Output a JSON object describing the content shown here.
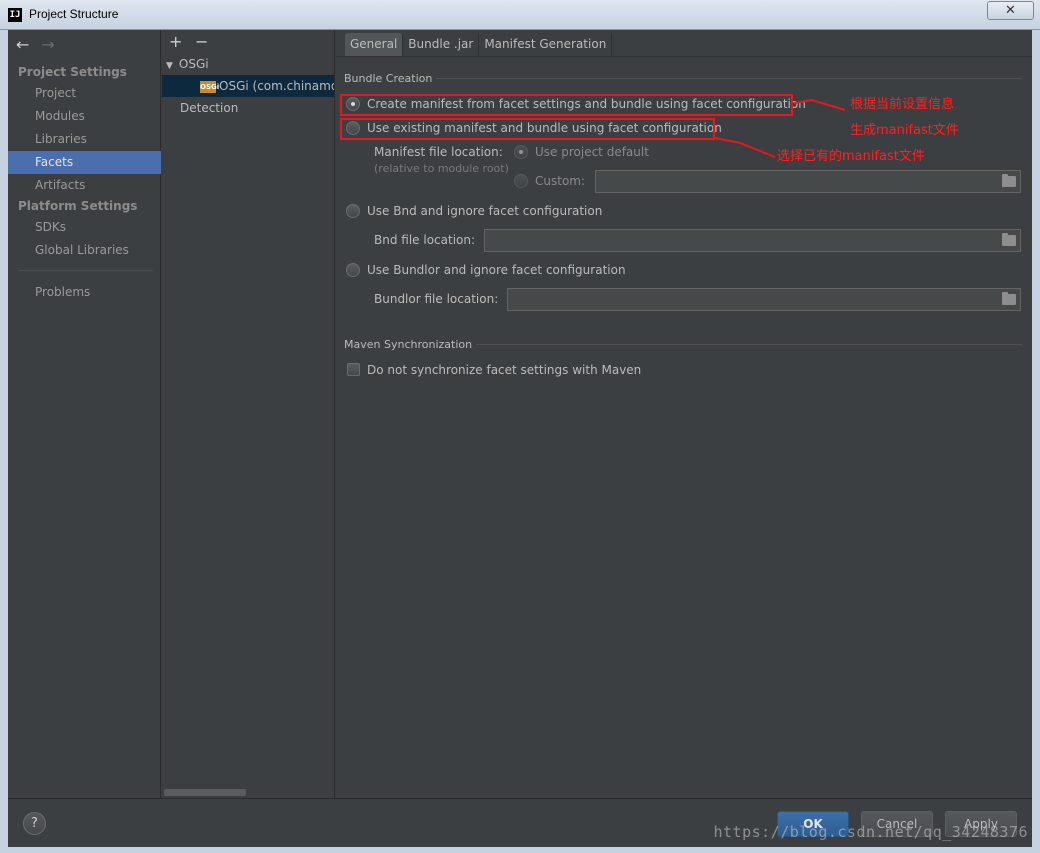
{
  "window": {
    "title": "Project Structure",
    "icon_text": "IJ",
    "close_glyph": "✕"
  },
  "nav": {
    "back_glyph": "←",
    "forward_glyph": "→",
    "project_settings_heading": "Project Settings",
    "project_items": [
      "Project",
      "Modules",
      "Libraries",
      "Facets",
      "Artifacts"
    ],
    "platform_settings_heading": "Platform Settings",
    "platform_items": [
      "SDKs",
      "Global Libraries"
    ],
    "problems": "Problems",
    "selected": "Facets",
    "selected_color": "#4b6eaf"
  },
  "tree": {
    "add_glyph": "+",
    "remove_glyph": "−",
    "group_label": "OSGi",
    "expand_glyph": "▼",
    "facet_badge": "OSGi",
    "facet_label": "OSGi (com.chinamol",
    "detection_label": "Detection"
  },
  "tabs": [
    "General",
    "Bundle .jar",
    "Manifest Generation"
  ],
  "bundle_creation": {
    "title": "Bundle Creation",
    "option_create": "Create manifest from facet settings and bundle using facet configuration",
    "option_existing": "Use existing manifest and bundle using facet configuration",
    "manifest_location_label": "Manifest file location:",
    "manifest_location_hint": "(relative to module root)",
    "use_project_default": "Use project default",
    "custom": "Custom:",
    "option_bnd": "Use Bnd and ignore facet configuration",
    "bnd_file_label": "Bnd file location:",
    "option_bundlor": "Use Bundlor and ignore facet configuration",
    "bundlor_file_label": "Bundlor file location:",
    "selected_option": "create"
  },
  "maven": {
    "title": "Maven Synchronization",
    "checkbox_label": "Do not synchronize facet settings with Maven",
    "checked": false
  },
  "annotations": {
    "note1_line1": "根据当前设置信息",
    "note1_line2": "生成manifast文件",
    "note2": "选择已有的manifast文件",
    "color": "#e3191f"
  },
  "footer": {
    "help_glyph": "?",
    "ok": "OK",
    "cancel": "Cancel",
    "apply": "Apply",
    "watermark": "https://blog.csdn.net/qq_34248376"
  }
}
